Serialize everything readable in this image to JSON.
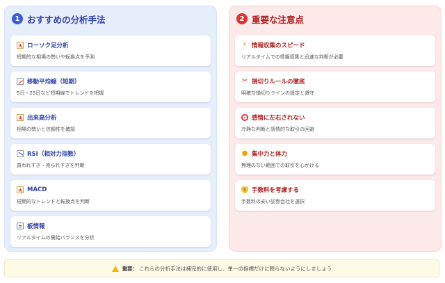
{
  "left_panel": {
    "number": "1",
    "title": "おすすめの分析手法",
    "items": [
      {
        "icon": "bar-chart-icon",
        "title": "ローソク足分析",
        "desc": "短期的な相場の勢いや転換点を予測"
      },
      {
        "icon": "chart-increasing-icon",
        "title": "移動平均線（短期）",
        "desc": "5日・25日など短期線でトレンドを把握"
      },
      {
        "icon": "bar-chart-icon",
        "title": "出来高分析",
        "desc": "相場の勢いと信頼性を確認"
      },
      {
        "icon": "chart-decreasing-icon",
        "title": "RSI（相対力指数）",
        "desc": "買われすぎ・売られすぎを判断"
      },
      {
        "icon": "bar-chart-icon",
        "title": "MACD",
        "desc": "短期的なトレンドと転換点を判断"
      },
      {
        "icon": "clipboard-icon",
        "title": "板情報",
        "desc": "リアルタイムの需給バランスを分析"
      }
    ]
  },
  "right_panel": {
    "number": "2",
    "title": "重要な注意点",
    "items": [
      {
        "icon": "lightning-icon",
        "title": "情報収集のスピード",
        "desc": "リアルタイムでの情報収集と迅速な判断が必要"
      },
      {
        "icon": "scissors-icon",
        "title": "損切りルールの徹底",
        "desc": "明確な損切りラインの設定と遵守"
      },
      {
        "icon": "target-icon",
        "title": "感情に左右されない",
        "desc": "冷静な判断と感情的な取引の回避"
      },
      {
        "icon": "flexed-biceps-icon",
        "title": "集中力と体力",
        "desc": "無理のない範囲での取引を心がける"
      },
      {
        "icon": "money-bag-icon",
        "title": "手数料を考慮する",
        "desc": "手数料の安い証券会社を選択"
      }
    ]
  },
  "footer": {
    "icon": "warning-icon",
    "label": "重要：",
    "text": "これらの分析手法は補完的に使用し、単一の指標だけに頼らないようにしましょう"
  },
  "colors": {
    "left_accent": "#3b5bdb",
    "right_accent": "#e03131",
    "left_bg": "#e6edfb",
    "right_bg": "#fce9e9",
    "footer_bg": "#fdfbe6"
  }
}
